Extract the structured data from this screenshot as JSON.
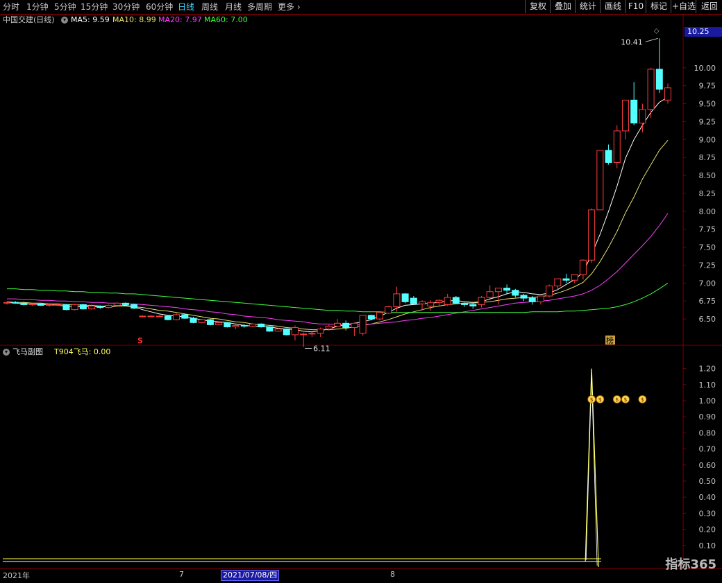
{
  "timeframes": [
    "分时",
    "1分钟",
    "5分钟",
    "15分钟",
    "30分钟",
    "60分钟",
    "日线",
    "周线",
    "月线",
    "多周期",
    "更多"
  ],
  "active_timeframe_index": 6,
  "more_arrow": "›",
  "right_buttons": [
    "复权",
    "叠加",
    "统计",
    "画线",
    "F10",
    "标记",
    "+自选",
    "返回"
  ],
  "stock": {
    "name": "中国交建(日线)"
  },
  "ma_legend": [
    {
      "label": "MA5: 9.59",
      "color": "#ffffff"
    },
    {
      "label": "MA10: 8.99",
      "color": "#e8e070"
    },
    {
      "label": "MA20: 7.97",
      "color": "#ff40ff"
    },
    {
      "label": "MA60: 7.00",
      "color": "#40ff40"
    }
  ],
  "current_price": "10.25",
  "annotations": {
    "high": "10.41",
    "low": "6.11"
  },
  "signal_marks": {
    "s": "S",
    "bang": "榜"
  },
  "sub_chart": {
    "title": "飞马副图",
    "indicator": "T904飞马: 0.00"
  },
  "bottom": {
    "year": "2021年",
    "month7": "7",
    "cursor_date": "2021/07/08/四",
    "month8": "8"
  },
  "watermark": "指标365",
  "chart_data": {
    "type": "candlestick",
    "main_axis": {
      "ticks": [
        "10.00",
        "9.75",
        "9.50",
        "9.25",
        "9.00",
        "8.75",
        "8.50",
        "8.25",
        "8.00",
        "7.75",
        "7.50",
        "7.25",
        "7.00",
        "6.75",
        "6.50"
      ],
      "min": 6.25,
      "max": 10.5
    },
    "sub_axis": {
      "ticks": [
        "1.20",
        "1.10",
        "1.00",
        "0.90",
        "0.80",
        "0.70",
        "0.60",
        "0.50",
        "0.40",
        "0.30",
        "0.20",
        "0.10"
      ],
      "min": 0,
      "max": 1.25
    },
    "candles": [
      [
        6.72,
        6.74,
        6.7,
        6.73
      ],
      [
        6.73,
        6.75,
        6.71,
        6.72
      ],
      [
        6.72,
        6.74,
        6.69,
        6.7
      ],
      [
        6.7,
        6.72,
        6.68,
        6.71
      ],
      [
        6.71,
        6.72,
        6.68,
        6.69
      ],
      [
        6.69,
        6.71,
        6.67,
        6.7
      ],
      [
        6.7,
        6.72,
        6.68,
        6.7
      ],
      [
        6.7,
        6.71,
        6.62,
        6.63
      ],
      [
        6.63,
        6.71,
        6.62,
        6.7
      ],
      [
        6.7,
        6.71,
        6.63,
        6.64
      ],
      [
        6.64,
        6.7,
        6.63,
        6.68
      ],
      [
        6.68,
        6.69,
        6.64,
        6.66
      ],
      [
        6.66,
        6.7,
        6.65,
        6.69
      ],
      [
        6.69,
        6.73,
        6.67,
        6.72
      ],
      [
        6.72,
        6.73,
        6.68,
        6.7
      ],
      [
        6.7,
        6.71,
        6.64,
        6.65
      ],
      [
        6.53,
        6.55,
        6.52,
        6.54
      ],
      [
        6.54,
        6.55,
        6.53,
        6.54
      ],
      [
        6.54,
        6.55,
        6.53,
        6.54
      ],
      [
        6.54,
        6.55,
        6.48,
        6.49
      ],
      [
        6.49,
        6.58,
        6.48,
        6.56
      ],
      [
        6.56,
        6.57,
        6.5,
        6.51
      ],
      [
        6.51,
        6.53,
        6.44,
        6.45
      ],
      [
        6.45,
        6.5,
        6.44,
        6.49
      ],
      [
        6.49,
        6.5,
        6.41,
        6.42
      ],
      [
        6.42,
        6.46,
        6.41,
        6.45
      ],
      [
        6.45,
        6.46,
        6.38,
        6.39
      ],
      [
        6.39,
        6.42,
        6.36,
        6.41
      ],
      [
        6.41,
        6.43,
        6.38,
        6.4
      ],
      [
        6.4,
        6.44,
        6.39,
        6.43
      ],
      [
        6.43,
        6.44,
        6.38,
        6.39
      ],
      [
        6.39,
        6.4,
        6.32,
        6.33
      ],
      [
        6.33,
        6.38,
        6.32,
        6.36
      ],
      [
        6.36,
        6.37,
        6.27,
        6.28
      ],
      [
        6.28,
        6.41,
        6.2,
        6.38
      ],
      [
        6.28,
        6.31,
        6.11,
        6.29
      ],
      [
        6.29,
        6.32,
        6.25,
        6.3
      ],
      [
        6.3,
        6.38,
        6.25,
        6.36
      ],
      [
        6.36,
        6.42,
        6.34,
        6.4
      ],
      [
        6.4,
        6.5,
        6.4,
        6.44
      ],
      [
        6.44,
        6.48,
        6.34,
        6.38
      ],
      [
        6.38,
        6.45,
        6.26,
        6.44
      ],
      [
        6.3,
        6.55,
        6.27,
        6.55
      ],
      [
        6.55,
        6.56,
        6.48,
        6.5
      ],
      [
        6.5,
        6.6,
        6.48,
        6.59
      ],
      [
        6.58,
        6.68,
        6.57,
        6.67
      ],
      [
        6.67,
        6.95,
        6.6,
        6.85
      ],
      [
        6.85,
        6.86,
        6.72,
        6.74
      ],
      [
        6.79,
        6.82,
        6.7,
        6.71
      ],
      [
        6.71,
        6.76,
        6.62,
        6.74
      ],
      [
        6.68,
        6.76,
        6.62,
        6.73
      ],
      [
        6.73,
        6.77,
        6.68,
        6.76
      ],
      [
        6.7,
        6.85,
        6.68,
        6.8
      ],
      [
        6.8,
        6.82,
        6.71,
        6.72
      ],
      [
        6.72,
        6.73,
        6.67,
        6.7
      ],
      [
        6.7,
        6.72,
        6.64,
        6.68
      ],
      [
        6.7,
        6.82,
        6.66,
        6.8
      ],
      [
        6.8,
        6.97,
        6.76,
        6.88
      ],
      [
        6.88,
        6.9,
        6.7,
        6.93
      ],
      [
        6.93,
        6.98,
        6.85,
        6.9
      ],
      [
        6.9,
        6.92,
        6.8,
        6.83
      ],
      [
        6.83,
        6.85,
        6.75,
        6.79
      ],
      [
        6.79,
        6.82,
        6.7,
        6.74
      ],
      [
        6.74,
        6.78,
        6.7,
        6.82
      ],
      [
        6.82,
        6.98,
        6.8,
        6.96
      ],
      [
        6.96,
        7.04,
        6.9,
        7.06
      ],
      [
        7.06,
        7.13,
        7.0,
        7.04
      ],
      [
        7.04,
        7.12,
        7.0,
        7.12
      ],
      [
        7.12,
        7.33,
        7.05,
        7.32
      ],
      [
        7.32,
        8.04,
        7.28,
        8.02
      ],
      [
        8.02,
        8.25,
        8.1,
        8.85
      ],
      [
        8.85,
        8.93,
        8.65,
        8.68
      ],
      [
        8.68,
        9.2,
        8.6,
        9.12
      ],
      [
        9.12,
        9.5,
        9.0,
        9.55
      ],
      [
        9.55,
        9.8,
        9.2,
        9.23
      ],
      [
        9.23,
        9.5,
        9.1,
        9.42
      ],
      [
        9.42,
        10.0,
        9.3,
        9.98
      ],
      [
        9.98,
        10.41,
        9.65,
        9.7
      ],
      [
        9.55,
        9.78,
        9.5,
        9.72
      ]
    ],
    "ma_series": [
      {
        "name": "MA5",
        "color": "#ffffff",
        "values": [
          6.73,
          6.72,
          6.71,
          6.71,
          6.7,
          6.7,
          6.69,
          6.68,
          6.67,
          6.67,
          6.67,
          6.67,
          6.67,
          6.68,
          6.69,
          6.67,
          6.63,
          6.6,
          6.57,
          6.55,
          6.54,
          6.53,
          6.51,
          6.49,
          6.47,
          6.46,
          6.45,
          6.43,
          6.41,
          6.4,
          6.4,
          6.39,
          6.37,
          6.36,
          6.35,
          6.33,
          6.32,
          6.34,
          6.36,
          6.4,
          6.42,
          6.44,
          6.46,
          6.49,
          6.54,
          6.59,
          6.65,
          6.69,
          6.7,
          6.71,
          6.72,
          6.73,
          6.75,
          6.76,
          6.74,
          6.73,
          6.74,
          6.78,
          6.81,
          6.85,
          6.88,
          6.87,
          6.85,
          6.84,
          6.86,
          6.91,
          6.98,
          7.05,
          7.15,
          7.4,
          7.68,
          8.0,
          8.35,
          8.74,
          9.0,
          9.2,
          9.38,
          9.52,
          9.59
        ]
      },
      {
        "name": "MA10",
        "color": "#e8e070",
        "values": [
          6.74,
          6.73,
          6.73,
          6.72,
          6.72,
          6.71,
          6.71,
          6.7,
          6.7,
          6.69,
          6.69,
          6.68,
          6.68,
          6.68,
          6.68,
          6.67,
          6.66,
          6.64,
          6.62,
          6.61,
          6.59,
          6.57,
          6.55,
          6.53,
          6.51,
          6.5,
          6.48,
          6.46,
          6.45,
          6.43,
          6.42,
          6.41,
          6.4,
          6.38,
          6.37,
          6.36,
          6.35,
          6.35,
          6.35,
          6.36,
          6.37,
          6.39,
          6.41,
          6.43,
          6.46,
          6.49,
          6.53,
          6.57,
          6.6,
          6.63,
          6.66,
          6.68,
          6.7,
          6.71,
          6.72,
          6.72,
          6.73,
          6.74,
          6.76,
          6.78,
          6.79,
          6.8,
          6.8,
          6.81,
          6.83,
          6.86,
          6.9,
          6.95,
          7.01,
          7.13,
          7.3,
          7.5,
          7.72,
          7.98,
          8.2,
          8.45,
          8.65,
          8.85,
          8.99
        ]
      },
      {
        "name": "MA20",
        "color": "#ff40ff",
        "values": [
          6.78,
          6.78,
          6.77,
          6.77,
          6.76,
          6.76,
          6.75,
          6.75,
          6.74,
          6.74,
          6.73,
          6.73,
          6.72,
          6.72,
          6.71,
          6.71,
          6.7,
          6.69,
          6.68,
          6.67,
          6.66,
          6.64,
          6.63,
          6.62,
          6.6,
          6.59,
          6.57,
          6.56,
          6.54,
          6.53,
          6.52,
          6.51,
          6.49,
          6.48,
          6.47,
          6.46,
          6.44,
          6.43,
          6.43,
          6.42,
          6.42,
          6.42,
          6.42,
          6.43,
          6.44,
          6.45,
          6.46,
          6.48,
          6.49,
          6.51,
          6.52,
          6.54,
          6.56,
          6.58,
          6.6,
          6.62,
          6.64,
          6.66,
          6.68,
          6.7,
          6.72,
          6.73,
          6.74,
          6.75,
          6.76,
          6.78,
          6.8,
          6.82,
          6.85,
          6.9,
          6.97,
          7.06,
          7.16,
          7.28,
          7.4,
          7.52,
          7.65,
          7.8,
          7.97
        ]
      },
      {
        "name": "MA60",
        "color": "#40ff40",
        "values": [
          6.92,
          6.92,
          6.91,
          6.91,
          6.9,
          6.9,
          6.89,
          6.89,
          6.88,
          6.88,
          6.87,
          6.87,
          6.86,
          6.86,
          6.85,
          6.85,
          6.84,
          6.83,
          6.82,
          6.81,
          6.8,
          6.79,
          6.78,
          6.77,
          6.76,
          6.75,
          6.74,
          6.73,
          6.72,
          6.71,
          6.7,
          6.69,
          6.68,
          6.67,
          6.66,
          6.65,
          6.64,
          6.63,
          6.62,
          6.62,
          6.61,
          6.61,
          6.6,
          6.6,
          6.6,
          6.59,
          6.59,
          6.59,
          6.59,
          6.59,
          6.59,
          6.59,
          6.59,
          6.59,
          6.59,
          6.59,
          6.59,
          6.59,
          6.59,
          6.59,
          6.59,
          6.59,
          6.6,
          6.6,
          6.6,
          6.6,
          6.61,
          6.61,
          6.62,
          6.63,
          6.64,
          6.65,
          6.67,
          6.7,
          6.74,
          6.79,
          6.85,
          6.92,
          7.0
        ]
      }
    ],
    "indicator_series": {
      "name": "T904飞马",
      "color": "#ffff40",
      "values": [
        0,
        0,
        0,
        0,
        0,
        0,
        0,
        0,
        0,
        0,
        0,
        0,
        0,
        0,
        0,
        0,
        0,
        0,
        0,
        0,
        0,
        0,
        0,
        0,
        0,
        0,
        0,
        0,
        0,
        0,
        0,
        0,
        0,
        0,
        0,
        0,
        0,
        0,
        0,
        0,
        0,
        0,
        0,
        0,
        0,
        0,
        0,
        0,
        0,
        0,
        0,
        0,
        0,
        0,
        0,
        0,
        0,
        0,
        0,
        0,
        0,
        0,
        0,
        0,
        0,
        0,
        0,
        0,
        0,
        1.2,
        0,
        0,
        0,
        0,
        0,
        0,
        0,
        0,
        0
      ]
    },
    "signal_icons_at": [
      69,
      70,
      72,
      73,
      75
    ]
  }
}
